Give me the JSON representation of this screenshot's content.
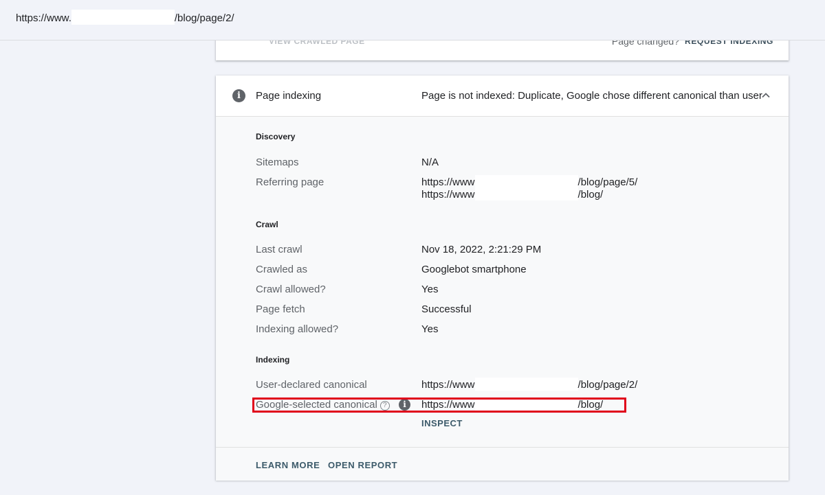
{
  "url_bar": {
    "prefix": "https://www.",
    "suffix": "/blog/page/2/"
  },
  "top_card": {
    "view_crawled": "VIEW CRAWLED PAGE",
    "page_changed": "Page changed?",
    "request_indexing": "REQUEST INDEXING"
  },
  "page_indexing": {
    "title": "Page indexing",
    "status": "Page is not indexed: Duplicate, Google chose different canonical than user",
    "sections": {
      "discovery": {
        "title": "Discovery",
        "sitemaps_label": "Sitemaps",
        "sitemaps_value": "N/A",
        "referring_label": "Referring page",
        "referring_1_prefix": "https://www",
        "referring_1_suffix": "/blog/page/5/",
        "referring_2_prefix": "https://www",
        "referring_2_suffix": "/blog/"
      },
      "crawl": {
        "title": "Crawl",
        "last_crawl_label": "Last crawl",
        "last_crawl_value": "Nov 18, 2022, 2:21:29 PM",
        "crawled_as_label": "Crawled as",
        "crawled_as_value": "Googlebot smartphone",
        "crawl_allowed_label": "Crawl allowed?",
        "crawl_allowed_value": "Yes",
        "page_fetch_label": "Page fetch",
        "page_fetch_value": "Successful",
        "indexing_allowed_label": "Indexing allowed?",
        "indexing_allowed_value": "Yes"
      },
      "indexing": {
        "title": "Indexing",
        "user_canonical_label": "User-declared canonical",
        "user_canonical_prefix": "https://www",
        "user_canonical_suffix": "/blog/page/2/",
        "google_canonical_label": "Google-selected canonical",
        "google_canonical_prefix": "https://www",
        "google_canonical_suffix": "/blog/",
        "inspect": "INSPECT"
      }
    },
    "footer": {
      "learn_more": "LEARN MORE",
      "open_report": "OPEN REPORT"
    }
  }
}
